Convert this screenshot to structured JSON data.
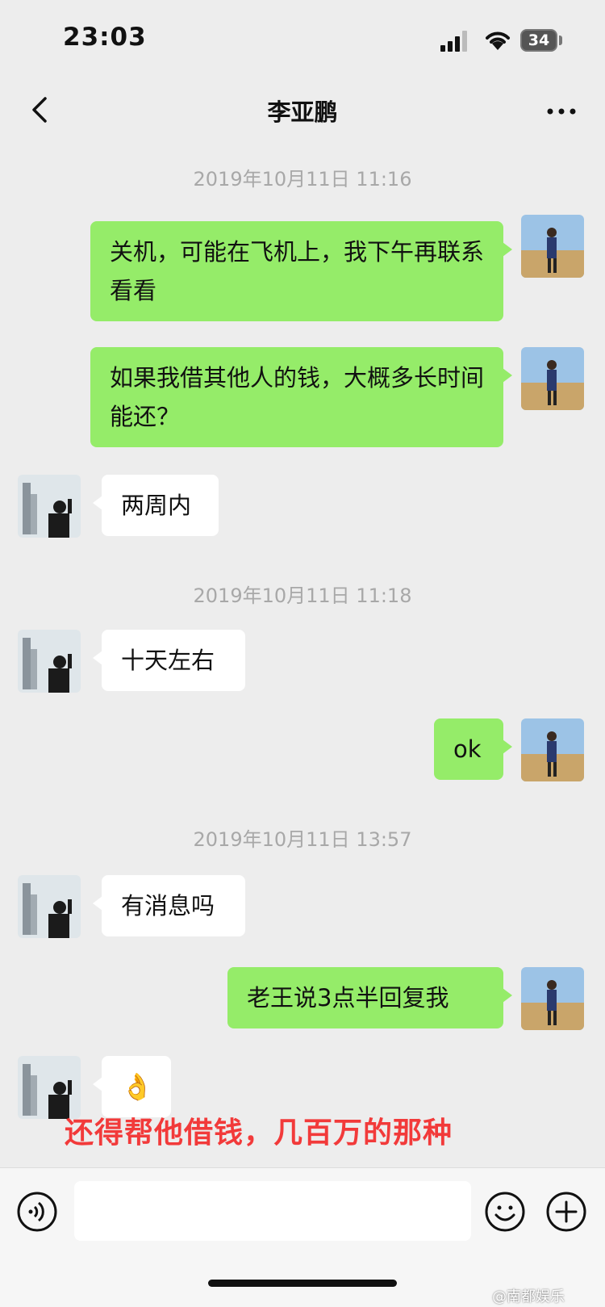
{
  "status_bar": {
    "time": "23:03",
    "battery": "34"
  },
  "header": {
    "title": "李亚鹏"
  },
  "messages": {
    "ts1": "2019年10月11日 11:16",
    "m1": "关机，可能在飞机上，我下午再联系看看",
    "m2": "如果我借其他人的钱，大概多长时间能还？",
    "m3": "两周内",
    "ts2": "2019年10月11日 11:18",
    "m4": "十天左右",
    "m5": "ok",
    "ts3": "2019年10月11日 13:57",
    "m6": "有消息吗",
    "m7": "老王说3点半回复我",
    "m8": "👌"
  },
  "overlay": {
    "caption": "还得帮他借钱，几百万的那种"
  },
  "watermark": {
    "text": "@南都娱乐"
  },
  "input": {
    "placeholder": ""
  },
  "colors": {
    "outgoing_bubble": "#95ec69",
    "incoming_bubble": "#ffffff",
    "background": "#ededed",
    "caption": "#f23a3a"
  }
}
